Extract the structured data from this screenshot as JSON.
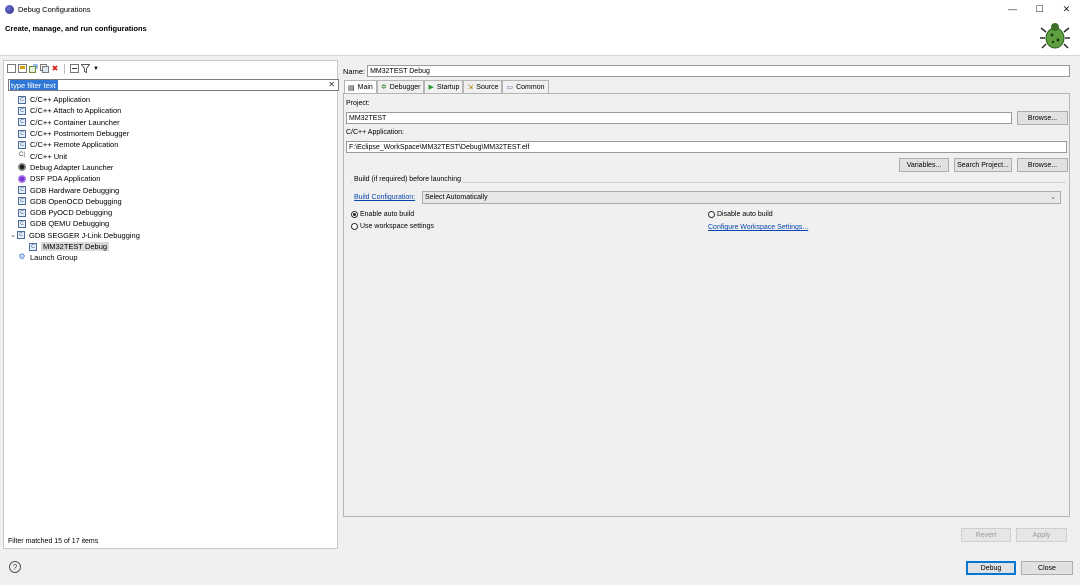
{
  "window": {
    "title": "Debug Configurations",
    "header_title": "Create, manage, and run configurations",
    "minimize_glyph": "—",
    "maximize_glyph": "☐",
    "close_glyph": "✕"
  },
  "left": {
    "toolbar_icons": [
      "new-config-icon",
      "new-prototype-icon",
      "export-icon",
      "duplicate-icon",
      "delete-icon",
      "collapse-all-icon",
      "filter-icon",
      "view-menu-icon"
    ],
    "filter_placeholder": "type filter text",
    "filter_value": "type filter text",
    "clear_glyph": "✕",
    "tree": [
      {
        "label": "C/C++ Application",
        "icon": "c-config-icon",
        "level": 0
      },
      {
        "label": "C/C++ Attach to Application",
        "icon": "c-config-icon",
        "level": 0
      },
      {
        "label": "C/C++ Container Launcher",
        "icon": "c-config-icon",
        "level": 0
      },
      {
        "label": "C/C++ Postmortem Debugger",
        "icon": "c-config-icon",
        "level": 0
      },
      {
        "label": "C/C++ Remote Application",
        "icon": "c-config-icon",
        "level": 0
      },
      {
        "label": "C/C++ Unit",
        "icon": "c-unit-icon",
        "level": 0
      },
      {
        "label": "Debug Adapter Launcher",
        "icon": "debug-adapter-icon",
        "level": 0
      },
      {
        "label": "DSF PDA Application",
        "icon": "dsf-icon",
        "level": 0
      },
      {
        "label": "GDB Hardware Debugging",
        "icon": "c-config-icon",
        "level": 0
      },
      {
        "label": "GDB OpenOCD Debugging",
        "icon": "c-config-icon",
        "level": 0
      },
      {
        "label": "GDB PyOCD Debugging",
        "icon": "c-config-icon",
        "level": 0
      },
      {
        "label": "GDB QEMU Debugging",
        "icon": "c-config-icon",
        "level": 0
      },
      {
        "label": "GDB SEGGER J-Link Debugging",
        "icon": "c-config-icon",
        "level": 0,
        "expanded": true
      },
      {
        "label": "MM32TEST Debug",
        "icon": "c-config-icon",
        "level": 1,
        "selected": true
      },
      {
        "label": "Launch Group",
        "icon": "launch-group-icon",
        "level": 0
      }
    ],
    "status": "Filter matched 15 of 17 items"
  },
  "right": {
    "name_label": "Name:",
    "name_value": "MM32TEST Debug",
    "tabs": [
      {
        "label": "Main",
        "icon": "main-tab-icon",
        "active": true
      },
      {
        "label": "Debugger",
        "icon": "debugger-tab-icon"
      },
      {
        "label": "Startup",
        "icon": "startup-tab-icon"
      },
      {
        "label": "Source",
        "icon": "source-tab-icon"
      },
      {
        "label": "Common",
        "icon": "common-tab-icon"
      }
    ],
    "project_label": "Project:",
    "project_value": "MM32TEST",
    "browse_label": "Browse...",
    "app_label": "C/C++ Application:",
    "app_value": "F:\\Eclipse_WorkSpace\\MM32TEST\\Debug\\MM32TEST.elf",
    "variables_label": "Variables...",
    "search_project_label": "Search Project...",
    "browse2_label": "Browse...",
    "build_group_label": "Build (if required) before launching",
    "build_config_label": "Build Configuration:",
    "build_config_value": "Select Automatically",
    "enable_auto_build": "Enable auto build",
    "disable_auto_build": "Disable auto build",
    "use_workspace": "Use workspace settings",
    "configure_workspace": "Configure Workspace Settings...",
    "revert_label": "Revert",
    "apply_label": "Apply"
  },
  "footer": {
    "help_glyph": "?",
    "debug_label": "Debug",
    "close_label": "Close"
  },
  "colors": {
    "accent": "#0078d7",
    "selection": "#3078d8",
    "link": "#0645ad"
  }
}
